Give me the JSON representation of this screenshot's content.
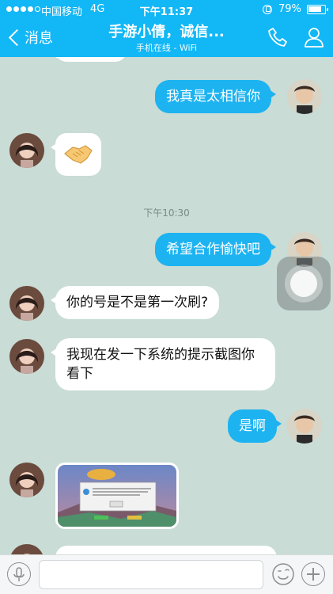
{
  "status_bar": {
    "carrier": "中国移动",
    "network": "4G",
    "time": "下午11:37",
    "battery": "79%"
  },
  "nav": {
    "back_label": "消息",
    "title": "手游小倩，诚信...",
    "subtitle": "手机在线 - WiFi"
  },
  "messages": [
    {
      "from": "me",
      "text": "我真是太相信你"
    },
    {
      "from": "contact",
      "type": "emoji",
      "emoji": "handshake"
    },
    {
      "type": "timestamp",
      "text": "下午10:30"
    },
    {
      "from": "me",
      "text": "希望合作愉快吧"
    },
    {
      "from": "contact",
      "text": "你的号是不是第一次刷?"
    },
    {
      "from": "contact",
      "text": "我现在发一下系统的提示截图你看下"
    },
    {
      "from": "me",
      "text": "是啊"
    },
    {
      "from": "contact",
      "type": "image"
    }
  ],
  "input": {
    "placeholder": ""
  },
  "colors": {
    "nav_background": "#12b7f5",
    "outgoing_bubble": "#1db3f0",
    "incoming_bubble": "#ffffff",
    "chat_background": "#c9dcd6"
  }
}
